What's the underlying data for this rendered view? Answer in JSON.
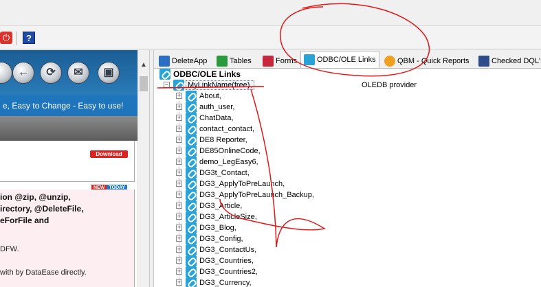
{
  "toolbar": {
    "icons": [
      "power-icon",
      "help-icon"
    ],
    "help_label": "?"
  },
  "left_pane": {
    "nav_buttons": [
      "back-icon",
      "refresh-icon",
      "mail-icon",
      "lock-icon"
    ],
    "tagline": "e, Easy to Change - Easy to use!",
    "download_label": "Download",
    "badge_new": "NEW",
    "badge_today": "TODAY",
    "func_lines": [
      "ion @zip, @unzip,",
      "irectory, @DeleteFile,",
      "eForFile and"
    ],
    "text_dfw": "DFW.",
    "text_with": "with by DataEase directly."
  },
  "tabs": [
    {
      "label": "DeleteApp",
      "icon": "deleteapp-icon",
      "active": false
    },
    {
      "label": "Tables",
      "icon": "tables-icon",
      "active": false
    },
    {
      "label": "Forms",
      "icon": "forms-icon",
      "active": false
    },
    {
      "label": "ODBC/OLE Links",
      "icon": "link-icon",
      "active": true
    },
    {
      "label": "QBM - Quick Reports",
      "icon": "qbm-icon",
      "active": false
    },
    {
      "label": "Checked DQL's",
      "icon": "dql-icon",
      "active": false
    }
  ],
  "tree": {
    "root_label": "ODBC/OLE Links",
    "link_name": "MyLinkName(free),",
    "provider": "OLEDB provider",
    "items": [
      "About,",
      "auth_user,",
      "ChatData,",
      "contact_contact,",
      "DE8 Reporter,",
      "DE85OnlineCode,",
      "demo_LegEasy6,",
      "DG3t_Contact,",
      "DG3_ApplyToPreLaunch,",
      "DG3_ApplyToPreLaunch_Backup,",
      "DG3_Article,",
      "DG3_ArticleSize,",
      "DG3_Blog,",
      "DG3_Config,",
      "DG3_ContactUs,",
      "DG3_Countries,",
      "DG3_Countries2,",
      "DG3_Currency,"
    ]
  },
  "annotation_color": "#e01818"
}
